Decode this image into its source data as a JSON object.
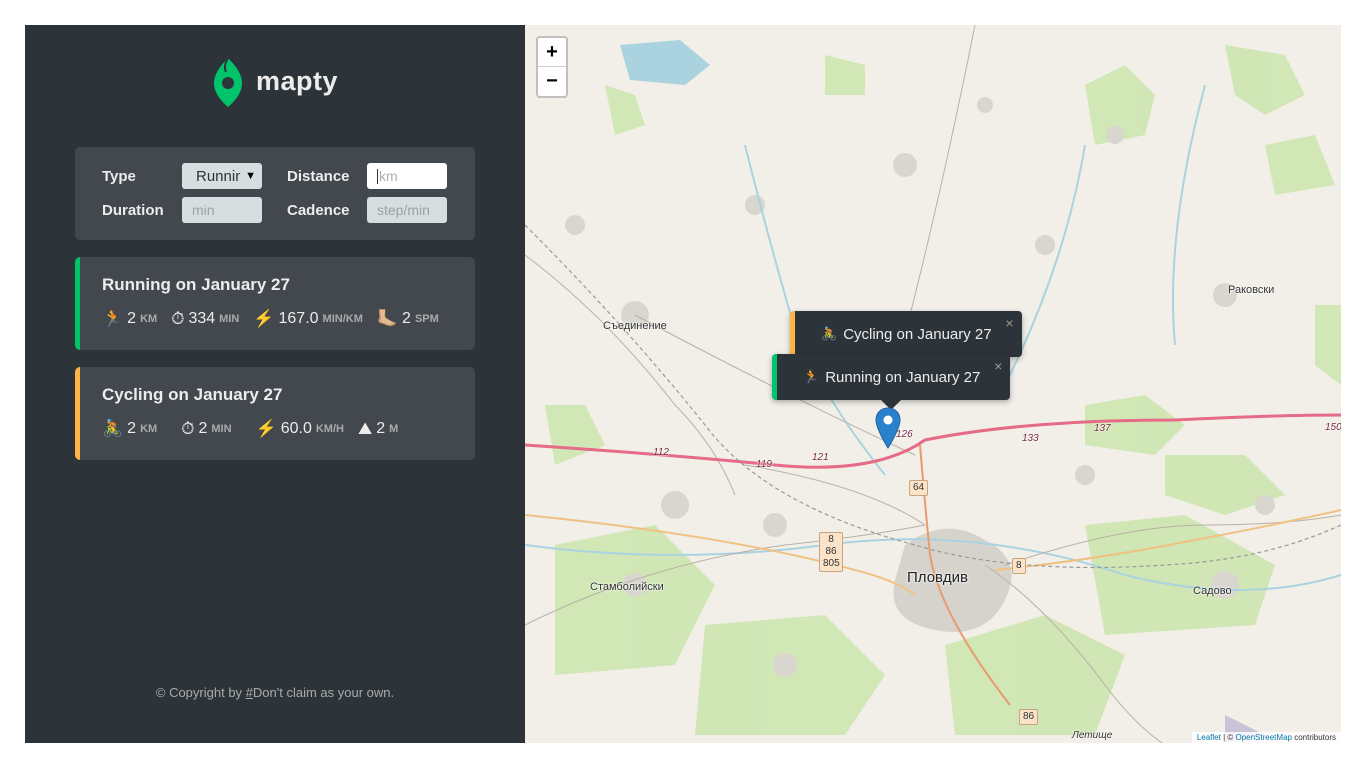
{
  "logo": {
    "text": "mapty"
  },
  "form": {
    "type_label": "Type",
    "type_value": "Running",
    "distance_label": "Distance",
    "distance_placeholder": "km",
    "duration_label": "Duration",
    "duration_placeholder": "min",
    "cadence_label": "Cadence",
    "cadence_placeholder": "step/min"
  },
  "workouts": [
    {
      "title": "Running on January 27",
      "kind": "running",
      "details": [
        {
          "icon": "🏃",
          "value": "2",
          "unit": "km"
        },
        {
          "icon": "⏱",
          "value": "334",
          "unit": "min"
        },
        {
          "icon": "⚡️",
          "value": "167.0",
          "unit": "min/km"
        },
        {
          "icon": "🦶🏼",
          "value": "2",
          "unit": "spm"
        }
      ]
    },
    {
      "title": "Cycling on January 27",
      "kind": "cycling",
      "details": [
        {
          "icon": "🚴",
          "value": "2",
          "unit": "km"
        },
        {
          "icon": "⏱",
          "value": "2",
          "unit": "min"
        },
        {
          "icon": "⚡️",
          "value": "60.0",
          "unit": "km/h"
        },
        {
          "icon": "⛰",
          "value": "2",
          "unit": "m"
        }
      ]
    }
  ],
  "copyright": {
    "prefix": "© Copyright by ",
    "link": "#",
    "suffix": "Don't claim as your own."
  },
  "map": {
    "zoom_in": "+",
    "zoom_out": "−",
    "popups": [
      {
        "icon": "🚴",
        "text": "Cycling on January 27",
        "close": "×"
      },
      {
        "icon": "🏃",
        "text": "Running on January 27",
        "close": "×"
      }
    ],
    "places": [
      "Съединение",
      "Раковски",
      "Пловдив",
      "Стамболийски",
      "Садово",
      "Летище"
    ],
    "road_numbers": [
      "112",
      "119",
      "121",
      "126",
      "133",
      "137",
      "150",
      "64",
      "8",
      "86",
      "805",
      "8",
      "86"
    ],
    "attribution": {
      "leaflet": "Leaflet",
      "sep": " | © ",
      "osm": "OpenStreetMap",
      "tail": " contributors"
    }
  },
  "colors": {
    "running": "#00c46a",
    "cycling": "#ffb545",
    "sidebar": "#2d3439",
    "card": "#42484d"
  }
}
